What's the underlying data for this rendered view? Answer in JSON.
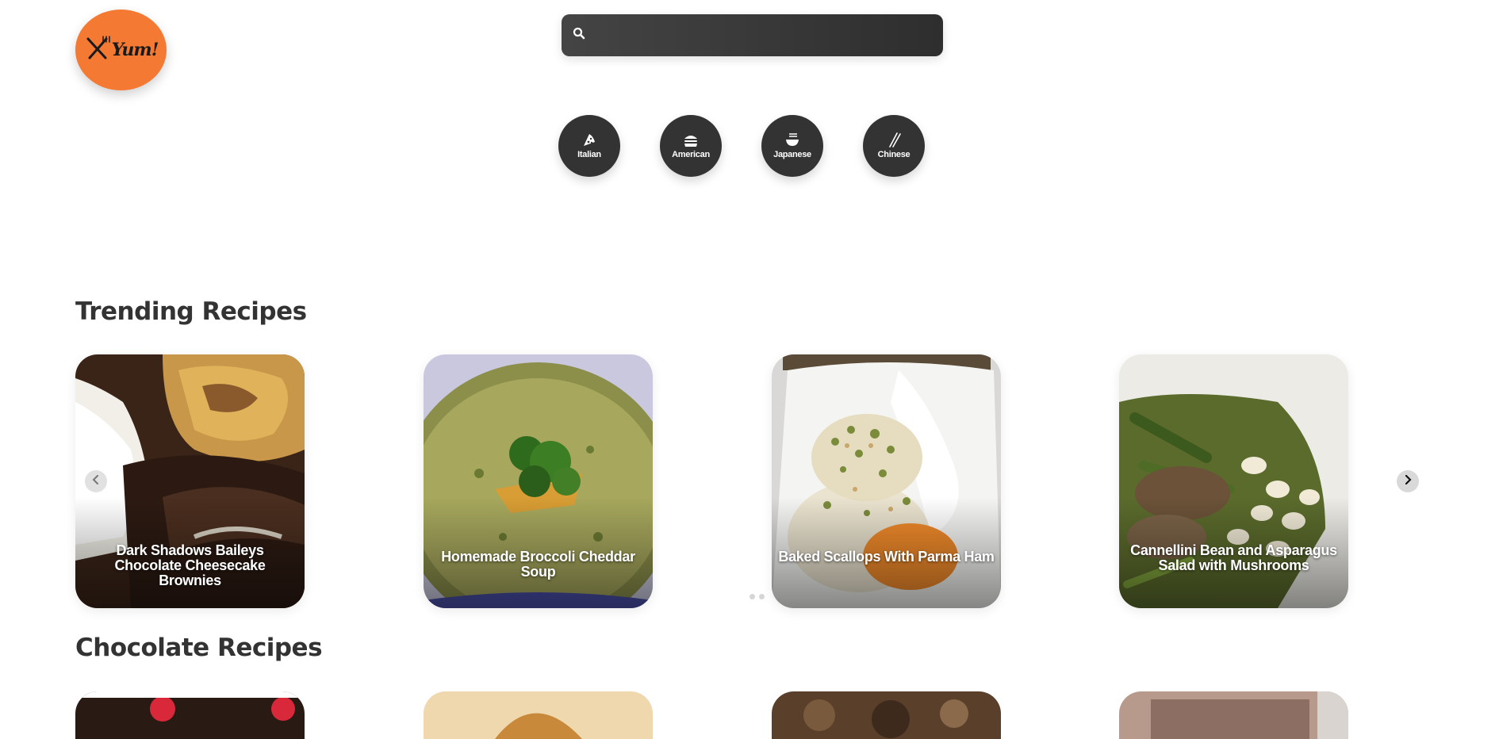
{
  "brand": {
    "logo_text": "Yum!"
  },
  "search": {
    "placeholder": "",
    "value": ""
  },
  "cuisines": [
    {
      "label": "Italian",
      "icon": "pizza-slice-icon"
    },
    {
      "label": "American",
      "icon": "hamburger-icon"
    },
    {
      "label": "Japanese",
      "icon": "ramen-bowl-icon"
    },
    {
      "label": "Chinese",
      "icon": "chopsticks-icon"
    }
  ],
  "sections": {
    "trending": {
      "title": "Trending Recipes",
      "recipes": [
        {
          "title": "Dark Shadows Baileys Chocolate Cheesecake Brownies"
        },
        {
          "title": "Homemade Broccoli Cheddar Soup"
        },
        {
          "title": "Baked Scallops With Parma Ham"
        },
        {
          "title": "Cannellini Bean and Asparagus Salad with Mushrooms"
        }
      ]
    },
    "chocolate": {
      "title": "Chocolate Recipes"
    }
  },
  "colors": {
    "brand_orange": "#f47a33",
    "dark_pill": "#333333",
    "text_dark": "#333333"
  }
}
